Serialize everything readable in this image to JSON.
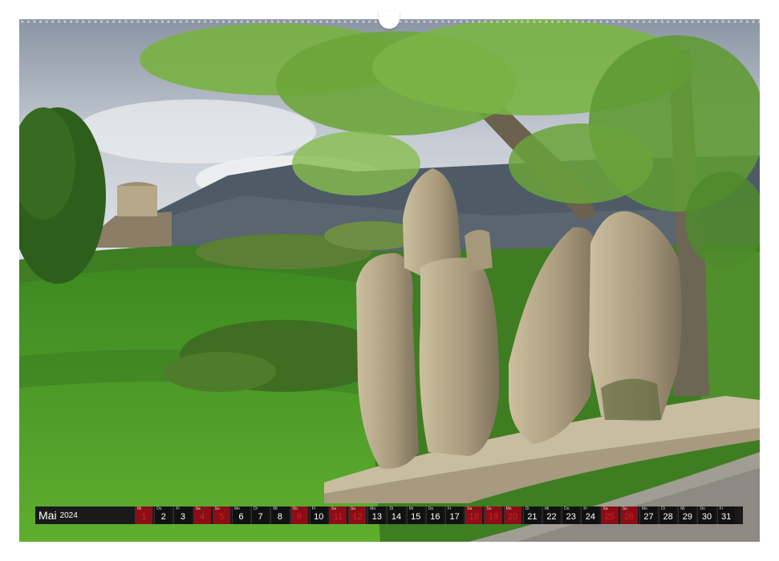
{
  "photo": {
    "subject": "standing-stones-landscape",
    "colors": {
      "sky": "#c9ced6",
      "grass": "#4d9a2a",
      "leaves": "#7fb544",
      "stone": "#b6a78c",
      "mountain": "#4d5a66"
    }
  },
  "calendar": {
    "month": "Mai",
    "year": "2024",
    "holiday_color": "#d21f2b",
    "days": [
      {
        "wd": "Mi",
        "num": "1",
        "red": true
      },
      {
        "wd": "Do",
        "num": "2",
        "red": false
      },
      {
        "wd": "Fr",
        "num": "3",
        "red": false
      },
      {
        "wd": "Sa",
        "num": "4",
        "red": true
      },
      {
        "wd": "So",
        "num": "5",
        "red": true
      },
      {
        "wd": "Mo",
        "num": "6",
        "red": false
      },
      {
        "wd": "Di",
        "num": "7",
        "red": false
      },
      {
        "wd": "Mi",
        "num": "8",
        "red": false
      },
      {
        "wd": "Do",
        "num": "9",
        "red": true
      },
      {
        "wd": "Fr",
        "num": "10",
        "red": false
      },
      {
        "wd": "Sa",
        "num": "11",
        "red": true
      },
      {
        "wd": "So",
        "num": "12",
        "red": true
      },
      {
        "wd": "Mo",
        "num": "13",
        "red": false
      },
      {
        "wd": "Di",
        "num": "14",
        "red": false
      },
      {
        "wd": "Mi",
        "num": "15",
        "red": false
      },
      {
        "wd": "Do",
        "num": "16",
        "red": false
      },
      {
        "wd": "Fr",
        "num": "17",
        "red": false
      },
      {
        "wd": "Sa",
        "num": "18",
        "red": true
      },
      {
        "wd": "So",
        "num": "19",
        "red": true
      },
      {
        "wd": "Mo",
        "num": "20",
        "red": true
      },
      {
        "wd": "Di",
        "num": "21",
        "red": false
      },
      {
        "wd": "Mi",
        "num": "22",
        "red": false
      },
      {
        "wd": "Do",
        "num": "23",
        "red": false
      },
      {
        "wd": "Fr",
        "num": "24",
        "red": false
      },
      {
        "wd": "Sa",
        "num": "25",
        "red": true
      },
      {
        "wd": "So",
        "num": "26",
        "red": true
      },
      {
        "wd": "Mo",
        "num": "27",
        "red": false
      },
      {
        "wd": "Di",
        "num": "28",
        "red": false
      },
      {
        "wd": "Mi",
        "num": "29",
        "red": false
      },
      {
        "wd": "Do",
        "num": "30",
        "red": false
      },
      {
        "wd": "Fr",
        "num": "31",
        "red": false
      }
    ]
  }
}
